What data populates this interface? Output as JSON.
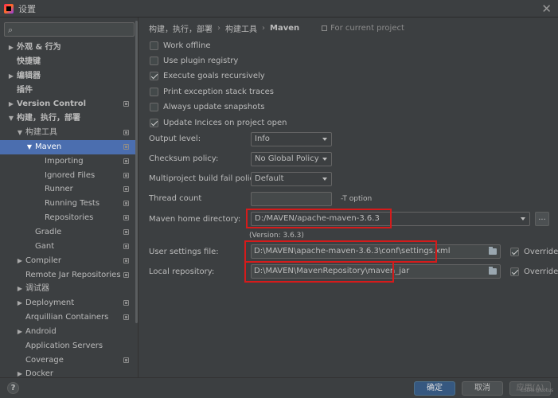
{
  "window": {
    "title": "设置",
    "close_glyph": "✕"
  },
  "search": {
    "value": "",
    "placeholder": "",
    "icon": "search-icon"
  },
  "tree": [
    {
      "label": "外观 & 行为",
      "indent": 0,
      "arrow": "▶",
      "bold": true
    },
    {
      "label": "快捷键",
      "indent": 0,
      "arrow": "",
      "bold": true
    },
    {
      "label": "编辑器",
      "indent": 0,
      "arrow": "▶",
      "bold": true
    },
    {
      "label": "插件",
      "indent": 0,
      "arrow": "",
      "bold": true
    },
    {
      "label": "Version Control",
      "indent": 0,
      "arrow": "▶",
      "bold": true,
      "proj": true
    },
    {
      "label": "构建，执行，部署",
      "indent": 0,
      "arrow": "▼",
      "bold": true
    },
    {
      "label": "构建工具",
      "indent": 1,
      "arrow": "▼",
      "proj": true
    },
    {
      "label": "Maven",
      "indent": 2,
      "arrow": "▼",
      "selected": true,
      "proj": true
    },
    {
      "label": "Importing",
      "indent": 3,
      "arrow": "",
      "proj": true
    },
    {
      "label": "Ignored Files",
      "indent": 3,
      "arrow": "",
      "proj": true
    },
    {
      "label": "Runner",
      "indent": 3,
      "arrow": "",
      "proj": true
    },
    {
      "label": "Running Tests",
      "indent": 3,
      "arrow": "",
      "proj": true
    },
    {
      "label": "Repositories",
      "indent": 3,
      "arrow": "",
      "proj": true
    },
    {
      "label": "Gradle",
      "indent": 2,
      "arrow": "",
      "proj": true
    },
    {
      "label": "Gant",
      "indent": 2,
      "arrow": "",
      "proj": true
    },
    {
      "label": "Compiler",
      "indent": 1,
      "arrow": "▶",
      "proj": true
    },
    {
      "label": "Remote Jar Repositories",
      "indent": 1,
      "arrow": "",
      "proj": true
    },
    {
      "label": "调试器",
      "indent": 1,
      "arrow": "▶"
    },
    {
      "label": "Deployment",
      "indent": 1,
      "arrow": "▶",
      "proj": true
    },
    {
      "label": "Arquillian Containers",
      "indent": 1,
      "arrow": "",
      "proj": true
    },
    {
      "label": "Android",
      "indent": 1,
      "arrow": "▶"
    },
    {
      "label": "Application Servers",
      "indent": 1,
      "arrow": ""
    },
    {
      "label": "Coverage",
      "indent": 1,
      "arrow": "",
      "proj": true
    },
    {
      "label": "Docker",
      "indent": 1,
      "arrow": "▶"
    }
  ],
  "breadcrumb": {
    "items": [
      "构建，执行，部署",
      "构建工具",
      "Maven"
    ],
    "separator": "›",
    "scope": "For current project"
  },
  "checkboxes": [
    {
      "label": "Work offline",
      "checked": false
    },
    {
      "label": "Use plugin registry",
      "checked": false
    },
    {
      "label": "Execute goals recursively",
      "checked": true
    },
    {
      "label": "Print exception stack traces",
      "checked": false
    },
    {
      "label": "Always update snapshots",
      "checked": false
    },
    {
      "label": "Update Incices on project open",
      "checked": true
    }
  ],
  "form": {
    "output_level": {
      "label": "Output level:",
      "value": "Info"
    },
    "checksum_policy": {
      "label": "Checksum policy:",
      "value": "No Global Policy"
    },
    "multiproject_policy": {
      "label": "Multiproject build fail policy:",
      "value": "Default"
    },
    "thread_count": {
      "label": "Thread count",
      "value": "",
      "hint": "-T option"
    },
    "maven_home": {
      "label": "Maven home directory:",
      "value": "D:/MAVEN/apache-maven-3.6.3",
      "version": "(Version: 3.6.3)",
      "browse": "..."
    },
    "user_settings": {
      "label": "User settings file:",
      "value": "D:\\MAVEN\\apache-maven-3.6.3\\conf\\settings.xml",
      "override_label": "Override",
      "override_checked": true
    },
    "local_repo": {
      "label": "Local repository:",
      "value": "D:\\MAVEN\\MavenRepository\\maven_jar",
      "override_label": "Override",
      "override_checked": true
    }
  },
  "buttons": {
    "ok": "确定",
    "cancel": "取消",
    "apply": "应用(A)",
    "help": "?"
  },
  "watermark": "CSDN @Lotus",
  "colors": {
    "selection": "#4b6eaf",
    "highlight_box": "#d51b1b",
    "primary_button": "#365880"
  }
}
